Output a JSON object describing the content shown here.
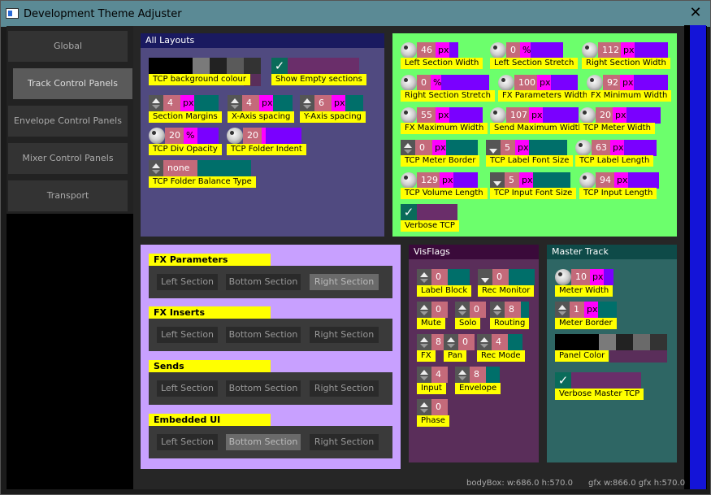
{
  "window": {
    "title": "Development Theme Adjuster",
    "close": "✕"
  },
  "tabs": [
    "Global",
    "Track Control Panels",
    "Envelope Control Panels",
    "Mixer Control Panels",
    "Transport"
  ],
  "all_layouts": {
    "title": "All Layouts",
    "bg_label": "TCP background colour",
    "show_empty_label": "Show Empty sections",
    "check": "✓",
    "section_margins": {
      "value": "4",
      "unit": "px",
      "label": "Section Margins"
    },
    "x_spacing": {
      "value": "4",
      "unit": "px",
      "label": "X-Axis spacing"
    },
    "y_spacing": {
      "value": "6",
      "unit": "px",
      "label": "Y-Axis spacing"
    },
    "div_opacity": {
      "value": "20",
      "unit": "%",
      "label": "TCP Div Opacity"
    },
    "folder_indent": {
      "value": "20",
      "unit": "",
      "label": "TCP Folder Indent"
    },
    "folder_balance": {
      "value": "none",
      "label": "TCP Folder Balance Type"
    }
  },
  "tcp": {
    "left_w": {
      "value": "46",
      "unit": "px",
      "label": "Left Section Width"
    },
    "left_s": {
      "value": "0",
      "unit": "%",
      "label": "Left Section Stretch"
    },
    "right_w": {
      "value": "112",
      "unit": "px",
      "label": "Right Section Width"
    },
    "right_s": {
      "value": "0",
      "unit": "%",
      "label": "Right Section Stretch"
    },
    "fxp_w": {
      "value": "100",
      "unit": "px",
      "label": "FX Parameters Width"
    },
    "fx_min": {
      "value": "92",
      "unit": "px",
      "label": "FX Minimum Width"
    },
    "fx_max": {
      "value": "55",
      "unit": "px",
      "label": "FX Maximum Width"
    },
    "send_max": {
      "value": "107",
      "unit": "px",
      "label": "Send Maximum Width"
    },
    "meter_w": {
      "value": "20",
      "unit": "px",
      "label": "TCP Meter Width"
    },
    "meter_b": {
      "value": "0",
      "unit": "px",
      "label": "TCP Meter Border"
    },
    "label_font": {
      "value": "5",
      "unit": "px",
      "label": "TCP Label Font Size"
    },
    "label_len": {
      "value": "63",
      "unit": "px",
      "label": "TCP Label Length"
    },
    "vol_len": {
      "value": "129",
      "unit": "px",
      "label": "TCP Volume Length"
    },
    "input_font": {
      "value": "5",
      "unit": "px",
      "label": "TCP Input Font Size"
    },
    "input_len": {
      "value": "94",
      "unit": "px",
      "label": "TCP Input Length"
    },
    "verbose": "Verbose TCP"
  },
  "sections": {
    "groups": [
      "FX Parameters",
      "FX Inserts",
      "Sends",
      "Embedded UI"
    ],
    "buttons": [
      "Left Section",
      "Bottom Section",
      "Right Section"
    ]
  },
  "visflags": {
    "title": "VisFlags",
    "label_block": {
      "value": "0",
      "label": "Label Block"
    },
    "rec_monitor": {
      "value": "0",
      "label": "Rec Monitor"
    },
    "mute": {
      "value": "0",
      "label": "Mute"
    },
    "solo": {
      "value": "0",
      "label": "Solo"
    },
    "routing": {
      "value": "8",
      "label": "Routing"
    },
    "fx": {
      "value": "8",
      "label": "FX"
    },
    "pan": {
      "value": "0",
      "label": "Pan"
    },
    "rec_mode": {
      "value": "4",
      "label": "Rec Mode"
    },
    "input": {
      "value": "4",
      "label": "Input"
    },
    "envelope": {
      "value": "8",
      "label": "Envelope"
    },
    "phase": {
      "value": "0",
      "label": "Phase"
    }
  },
  "master": {
    "title": "Master Track",
    "meter_w": {
      "value": "10",
      "unit": "px",
      "label": "Meter Width"
    },
    "meter_b": {
      "value": "1",
      "unit": "px",
      "label": "Meter Border"
    },
    "panel_color": "Panel Color",
    "verbose": "Verbose Master TCP"
  },
  "status": {
    "body": "bodyBox: w:686.0  h:570.0",
    "gfx": "gfx w:866.0  gfx h:570.0"
  }
}
